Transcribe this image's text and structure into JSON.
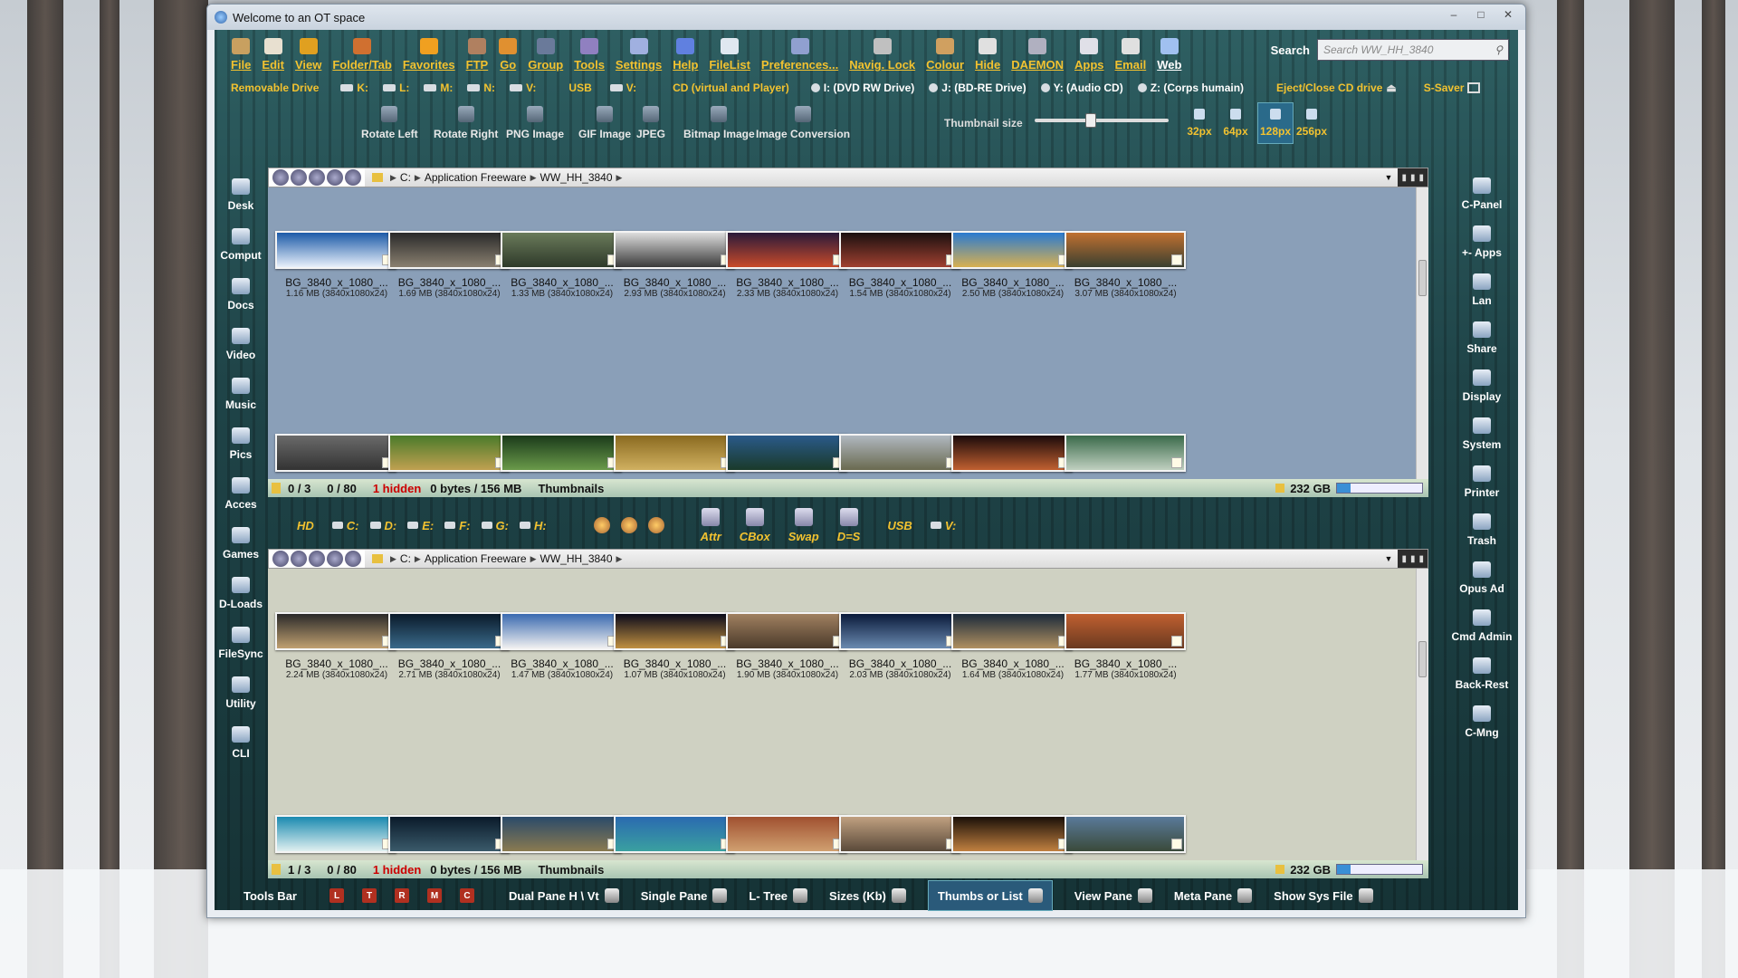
{
  "window": {
    "title": "Welcome to an OT space"
  },
  "toolbar": {
    "items": [
      {
        "label": "File",
        "icon": "folder-icon"
      },
      {
        "label": "Edit",
        "icon": "edit-icon"
      },
      {
        "label": "View",
        "icon": "view-icon"
      },
      {
        "label": "Folder/Tab",
        "icon": "folder-tab-icon"
      },
      {
        "label": "Favorites",
        "icon": "heart-icon"
      },
      {
        "label": "FTP",
        "icon": "ftp-icon"
      },
      {
        "label": "Go",
        "icon": "go-icon"
      },
      {
        "label": "Group",
        "icon": "group-icon"
      },
      {
        "label": "Tools",
        "icon": "tools-icon"
      },
      {
        "label": "Settings",
        "icon": "settings-icon"
      },
      {
        "label": "Help",
        "icon": "help-icon"
      },
      {
        "label": "FileList",
        "icon": "filelist-icon"
      },
      {
        "label": "Preferences...",
        "icon": "preferences-icon"
      },
      {
        "label": "Navig. Lock",
        "icon": "lock-icon"
      },
      {
        "label": "Colour",
        "icon": "colour-icon"
      },
      {
        "label": "Hide",
        "icon": "hide-icon"
      },
      {
        "label": "DAEMON",
        "icon": "daemon-icon"
      },
      {
        "label": "Apps",
        "icon": "apps-icon"
      },
      {
        "label": "Email",
        "icon": "email-icon"
      },
      {
        "label": "Web",
        "icon": "web-icon"
      }
    ],
    "search_label": "Search",
    "search_placeholder": "Search WW_HH_3840"
  },
  "drivebar": {
    "removable": "Removable Drive",
    "drives": [
      "K:",
      "L:",
      "M:",
      "N:",
      "V:"
    ],
    "usb": "USB",
    "usb_drive": "V:",
    "cd": "CD (virtual and Player)",
    "optical": [
      "I: (DVD RW Drive)",
      "J: (BD-RE Drive)",
      "Y: (Audio CD)",
      "Z: (Corps humain)"
    ],
    "eject": "Eject/Close CD drive",
    "saver": "S-Saver"
  },
  "imagebar": {
    "items": [
      "Rotate Left",
      "Rotate Right",
      "PNG Image",
      "GIF Image",
      "JPEG",
      "Bitmap Image",
      "Image Conversion"
    ],
    "thumb_label": "Thumbnail size",
    "slider_value": 0.42,
    "sizes": [
      "32px",
      "64px",
      "128px",
      "256px"
    ],
    "selected_size": "128px"
  },
  "left_sidebar": [
    "Desk",
    "Comput",
    "Docs",
    "Video",
    "Music",
    "Pics",
    "Acces",
    "Games",
    "D-Loads",
    "FileSync",
    "Utility",
    "CLI"
  ],
  "right_sidebar": [
    "C-Panel",
    "+- Apps",
    "Lan",
    "Share",
    "Display",
    "System",
    "Printer",
    "Trash",
    "Opus Ad",
    "Cmd Admin",
    "Back-Rest",
    "C-Mng"
  ],
  "path": [
    "C:",
    "Application Freeware",
    "WW_HH_3840"
  ],
  "pane1": {
    "files": [
      {
        "name": "BG_3840_x_1080_...",
        "info": "1.16 MB (3840x1080x24)",
        "c1": "#1c5aa8",
        "c2": "#e8f0fa"
      },
      {
        "name": "BG_3840_x_1080_...",
        "info": "1.69 MB (3840x1080x24)",
        "c1": "#2a2a2a",
        "c2": "#8a8070"
      },
      {
        "name": "BG_3840_x_1080_...",
        "info": "1.33 MB (3840x1080x24)",
        "c1": "#6a7a5a",
        "c2": "#2e3a2a"
      },
      {
        "name": "BG_3840_x_1080_...",
        "info": "2.93 MB (3840x1080x24)",
        "c1": "#ddd",
        "c2": "#3a3a3a"
      },
      {
        "name": "BG_3840_x_1080_...",
        "info": "2.33 MB (3840x1080x24)",
        "c1": "#2a1a3a",
        "c2": "#c84a2a"
      },
      {
        "name": "BG_3840_x_1080_...",
        "info": "1.54 MB (3840x1080x24)",
        "c1": "#1a1010",
        "c2": "#a04030"
      },
      {
        "name": "BG_3840_x_1080_...",
        "info": "2.50 MB (3840x1080x24)",
        "c1": "#2a7ad0",
        "c2": "#d8b050"
      },
      {
        "name": "BG_3840_x_1080_...",
        "info": "3.07 MB (3840x1080x24)",
        "c1": "#c07030",
        "c2": "#3a4030"
      }
    ],
    "row2": [
      [
        "#6a6a6a",
        "#333"
      ],
      [
        "#4a7a2a",
        "#c0a050"
      ],
      [
        "#1a3a1a",
        "#6a9a4a"
      ],
      [
        "#8a6a20",
        "#d0b060"
      ],
      [
        "#2a5a8a",
        "#1a3a2a"
      ],
      [
        "#b0b8c0",
        "#6a6a50"
      ],
      [
        "#1a0a0a",
        "#c06030"
      ],
      [
        "#3a6a4a",
        "#c0d0c0"
      ]
    ],
    "status": {
      "sel": "0 / 3",
      "files": "0 / 80",
      "hidden": "1 hidden",
      "bytes": "0 bytes / 156 MB",
      "mode": "Thumbnails",
      "disk": "232 GB",
      "usage": 0.16
    }
  },
  "midbar": {
    "hd": "HD",
    "drives": [
      "C:",
      "D:",
      "E:",
      "F:",
      "G:",
      "H:"
    ],
    "tools": [
      "Attr",
      "CBox",
      "Swap",
      "D=S"
    ],
    "usb": "USB",
    "usb_drive": "V:"
  },
  "pane2": {
    "files": [
      {
        "name": "BG_3840_x_1080_...",
        "info": "2.24 MB (3840x1080x24)",
        "c1": "#2a2a2a",
        "c2": "#c0a070"
      },
      {
        "name": "BG_3840_x_1080_...",
        "info": "2.71 MB (3840x1080x24)",
        "c1": "#0a1a2a",
        "c2": "#3a6a8a"
      },
      {
        "name": "BG_3840_x_1080_...",
        "info": "1.47 MB (3840x1080x24)",
        "c1": "#3a6ab0",
        "c2": "#f0f0f0"
      },
      {
        "name": "BG_3840_x_1080_...",
        "info": "1.07 MB (3840x1080x24)",
        "c1": "#0a0a1a",
        "c2": "#c09040"
      },
      {
        "name": "BG_3840_x_1080_...",
        "info": "1.90 MB (3840x1080x24)",
        "c1": "#a08060",
        "c2": "#4a3a2a"
      },
      {
        "name": "BG_3840_x_1080_...",
        "info": "2.03 MB (3840x1080x24)",
        "c1": "#0a1a3a",
        "c2": "#6a8ab0"
      },
      {
        "name": "BG_3840_x_1080_...",
        "info": "1.64 MB (3840x1080x24)",
        "c1": "#1a2a3a",
        "c2": "#b09060"
      },
      {
        "name": "BG_3840_x_1080_...",
        "info": "1.77 MB (3840x1080x24)",
        "c1": "#c06030",
        "c2": "#6a3a20"
      }
    ],
    "row2": [
      [
        "#1a8ab0",
        "#e0f0f0"
      ],
      [
        "#0a1a2a",
        "#3a5a6a"
      ],
      [
        "#2a4a6a",
        "#8a7a50"
      ],
      [
        "#2a6ab0",
        "#3aa0a0"
      ],
      [
        "#a05030",
        "#d0a070"
      ],
      [
        "#c0a080",
        "#5a4a3a"
      ],
      [
        "#1a1008",
        "#c08040"
      ],
      [
        "#5a7a9a",
        "#3a4a3a"
      ]
    ],
    "status": {
      "sel": "1 / 3",
      "files": "0 / 80",
      "hidden": "1 hidden",
      "bytes": "0 bytes / 156 MB",
      "mode": "Thumbnails",
      "disk": "232 GB",
      "usage": 0.16
    }
  },
  "bottombar": {
    "tools_bar": "Tools Bar",
    "letters": [
      "L",
      "T",
      "R",
      "M",
      "C"
    ],
    "dual": "Dual Pane H \\ Vt",
    "single": "Single Pane",
    "ltree": "L- Tree",
    "sizes": "Sizes (Kb)",
    "thumbs": "Thumbs or List",
    "view": "View Pane",
    "meta": "Meta Pane",
    "sys": "Show Sys File"
  }
}
